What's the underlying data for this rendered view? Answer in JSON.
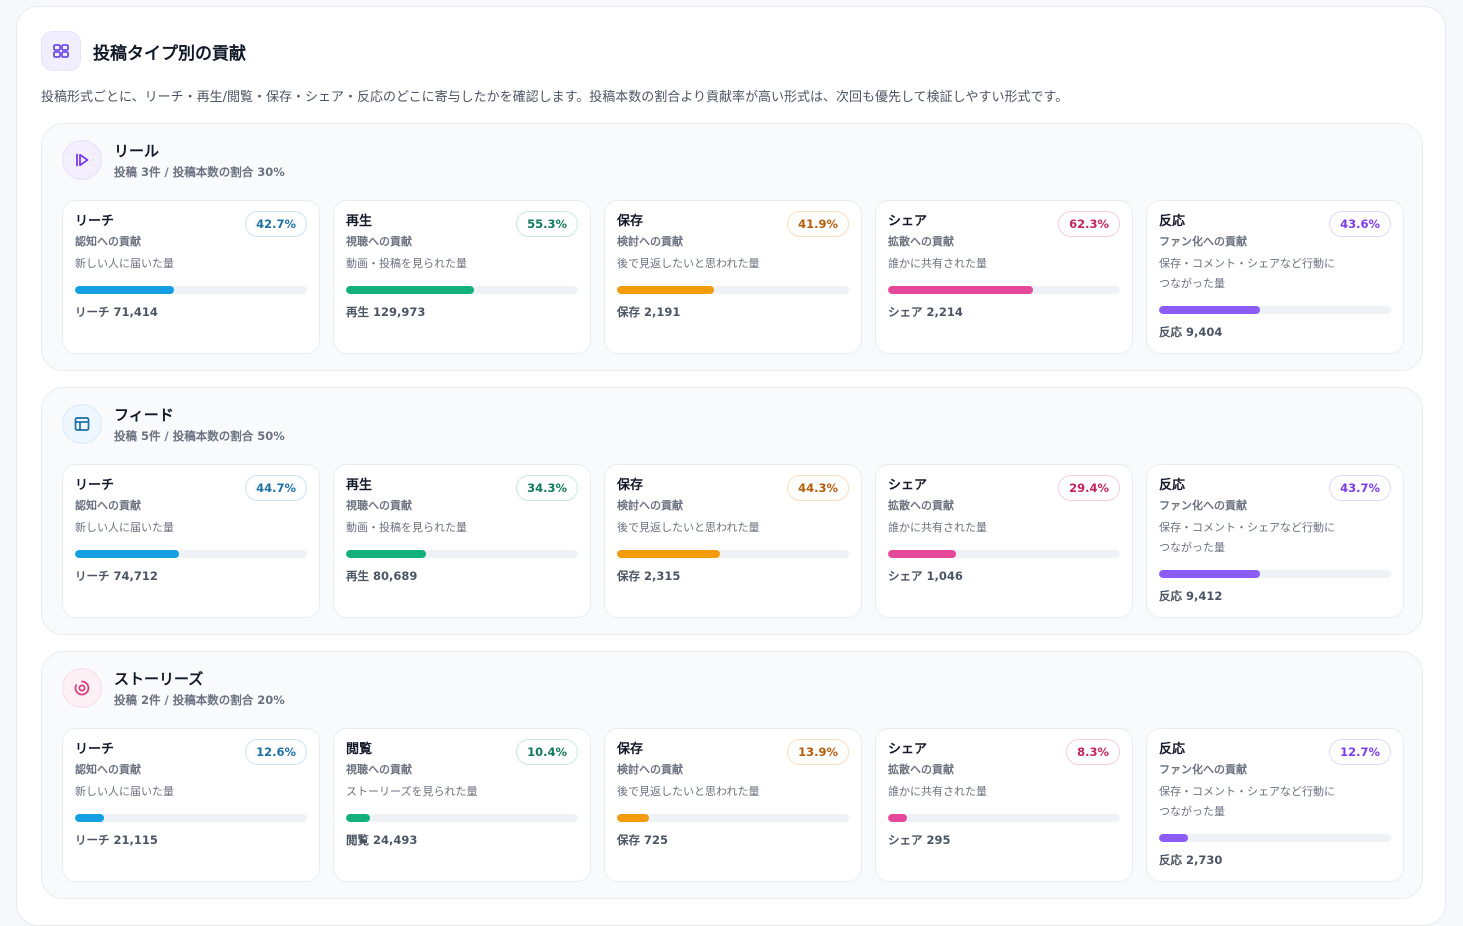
{
  "panel": {
    "title": "投稿タイプ別の貢献",
    "description": "投稿形式ごとに、リーチ・再生/閲覧・保存・シェア・反応のどこに寄与したかを確認します。投稿本数の割合より貢献率が高い形式は、次回も優先して検証しやすい形式です。",
    "icon": "grid-icon"
  },
  "types": [
    {
      "name": "リール",
      "subtitle": "投稿 3件 / 投稿本数の割合 30%",
      "icon": "reel-play-icon",
      "metrics": [
        {
          "label": "リーチ",
          "sub": "認知への貢献",
          "desc": "新しい人に届いた量",
          "pct": "42.7%",
          "fill": 42.7,
          "count": "リーチ 71,414"
        },
        {
          "label": "再生",
          "sub": "視聴への貢献",
          "desc": "動画・投稿を見られた量",
          "pct": "55.3%",
          "fill": 55.3,
          "count": "再生 129,973"
        },
        {
          "label": "保存",
          "sub": "検討への貢献",
          "desc": "後で見返したいと思われた量",
          "pct": "41.9%",
          "fill": 41.9,
          "count": "保存 2,191"
        },
        {
          "label": "シェア",
          "sub": "拡散への貢献",
          "desc": "誰かに共有された量",
          "pct": "62.3%",
          "fill": 62.3,
          "count": "シェア 2,214"
        },
        {
          "label": "反応",
          "sub": "ファン化への貢献",
          "desc": "保存・コメント・シェアなど行動につながった量",
          "pct": "43.6%",
          "fill": 43.6,
          "count": "反応 9,404"
        }
      ]
    },
    {
      "name": "フィード",
      "subtitle": "投稿 5件 / 投稿本数の割合 50%",
      "icon": "feed-layout-icon",
      "metrics": [
        {
          "label": "リーチ",
          "sub": "認知への貢献",
          "desc": "新しい人に届いた量",
          "pct": "44.7%",
          "fill": 44.7,
          "count": "リーチ 74,712"
        },
        {
          "label": "再生",
          "sub": "視聴への貢献",
          "desc": "動画・投稿を見られた量",
          "pct": "34.3%",
          "fill": 34.3,
          "count": "再生 80,689"
        },
        {
          "label": "保存",
          "sub": "検討への貢献",
          "desc": "後で見返したいと思われた量",
          "pct": "44.3%",
          "fill": 44.3,
          "count": "保存 2,315"
        },
        {
          "label": "シェア",
          "sub": "拡散への貢献",
          "desc": "誰かに共有された量",
          "pct": "29.4%",
          "fill": 29.4,
          "count": "シェア 1,046"
        },
        {
          "label": "反応",
          "sub": "ファン化への貢献",
          "desc": "保存・コメント・シェアなど行動につながった量",
          "pct": "43.7%",
          "fill": 43.7,
          "count": "反応 9,412"
        }
      ]
    },
    {
      "name": "ストーリーズ",
      "subtitle": "投稿 2件 / 投稿本数の割合 20%",
      "icon": "stories-ring-icon",
      "metrics": [
        {
          "label": "リーチ",
          "sub": "認知への貢献",
          "desc": "新しい人に届いた量",
          "pct": "12.6%",
          "fill": 12.6,
          "count": "リーチ 21,115"
        },
        {
          "label": "閲覧",
          "sub": "視聴への貢献",
          "desc": "ストーリーズを見られた量",
          "pct": "10.4%",
          "fill": 10.4,
          "count": "閲覧 24,493"
        },
        {
          "label": "保存",
          "sub": "検討への貢献",
          "desc": "後で見返したいと思われた量",
          "pct": "13.9%",
          "fill": 13.9,
          "count": "保存 725"
        },
        {
          "label": "シェア",
          "sub": "拡散への貢献",
          "desc": "誰かに共有された量",
          "pct": "8.3%",
          "fill": 8.3,
          "count": "シェア 295"
        },
        {
          "label": "反応",
          "sub": "ファン化への貢献",
          "desc": "保存・コメント・シェアなど行動につながった量",
          "pct": "12.7%",
          "fill": 12.7,
          "count": "反応 2,730"
        }
      ]
    }
  ],
  "colors": {
    "reach": "#12a0e2",
    "play": "#12b07a",
    "save": "#f29b0c",
    "share": "#e5479a",
    "reaction": "#8b5cf6"
  }
}
